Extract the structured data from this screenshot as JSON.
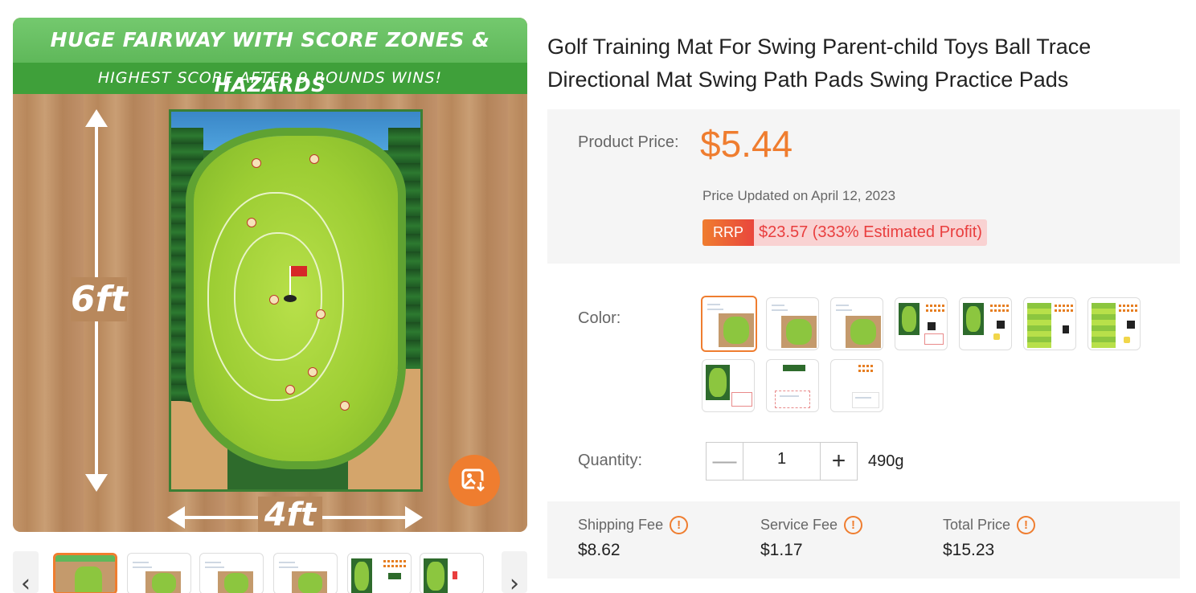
{
  "main_image": {
    "banner_line1": "HUGE FAIRWAY WITH SCORE ZONES & HAZARDS",
    "banner_line2": "HIGHEST SCORE AFTER 9 ROUNDS WINS!",
    "height_label": "6ft",
    "width_label": "4ft",
    "download_icon": "image-download-icon"
  },
  "thumbnail_strip": {
    "prev_label": "‹",
    "next_label": "›",
    "count": 6,
    "active_index": 0
  },
  "product": {
    "title": "Golf Training Mat For Swing Parent-child Toys Ball Trace Directional Mat Swing Path Pads Swing Practice Pads"
  },
  "price": {
    "label": "Product Price:",
    "value": "$5.44",
    "updated": "Price Updated on April 12, 2023",
    "rrp_tag": "RRP",
    "rrp_text": "$23.57 (333% Estimated Profit)"
  },
  "color": {
    "label": "Color:",
    "swatch_count": 10,
    "selected_index": 0
  },
  "quantity": {
    "label": "Quantity:",
    "minus_label": "—",
    "value": "1",
    "plus_label": "+",
    "weight": "490g"
  },
  "fees": {
    "shipping_label": "Shipping Fee",
    "shipping_value": "$8.62",
    "service_label": "Service Fee",
    "service_value": "$1.17",
    "total_label": "Total Price",
    "total_value": "$15.23",
    "info_glyph": "!"
  },
  "colors": {
    "accent": "#ef7d2f",
    "rrp_text": "#e93e3e",
    "panel_bg": "#f5f5f5"
  }
}
